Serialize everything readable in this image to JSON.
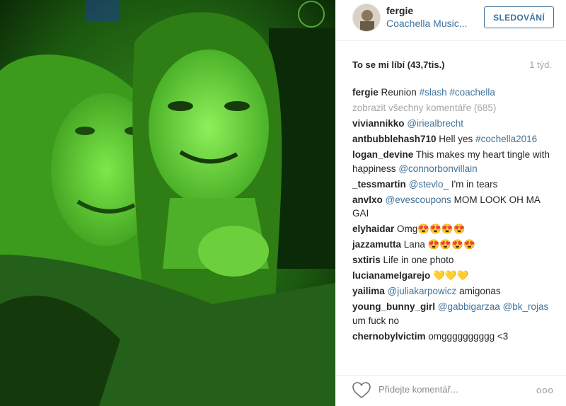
{
  "header": {
    "username": "fergie",
    "location": "Coachella Music...",
    "follow_label": "SLEDOVÁNÍ"
  },
  "stats": {
    "likes": "To se mi líbí (43,7tis.)",
    "time": "1 týd."
  },
  "caption": {
    "user": "fergie",
    "text": "Reunion",
    "tags": [
      "#slash",
      "#coachella"
    ]
  },
  "view_all": "zobrazit všechny komentáře (685)",
  "comments": [
    {
      "user": "viviannikko",
      "tag1": "@iriealbrecht",
      "text": ""
    },
    {
      "user": "antbubblehash710",
      "text": "Hell yes",
      "tag1": "#cochella2016"
    },
    {
      "user": "logan_devine",
      "text": "This makes my heart tingle with happiness",
      "tag1": "@connorbonvillain"
    },
    {
      "user": "_tessmartin",
      "tag1": "@stevlo_",
      "text": "I'm in tears"
    },
    {
      "user": "anvlxo",
      "tag1": "@evescoupons",
      "text": "MOM LOOK OH MA GAI"
    },
    {
      "user": "elyhaidar",
      "text": "Omg😍😍😍😍"
    },
    {
      "user": "jazzamutta",
      "text": "Lana 😍😍😍😍"
    },
    {
      "user": "sxtiris",
      "text": "Life in one photo"
    },
    {
      "user": "lucianamelgarejo",
      "text": "💛💛💛"
    },
    {
      "user": "yailima",
      "tag1": "@juliakarpowicz",
      "text": "amigonas"
    },
    {
      "user": "young_bunny_girl",
      "tag1": "@gabbigarzaa",
      "tag2": "@bk_rojas",
      "text": "um fuck no"
    },
    {
      "user": "chernobylvictim",
      "text": "omgggggggggg <3"
    }
  ],
  "footer": {
    "placeholder": "Přidejte komentář...",
    "more": "ooo"
  },
  "icons": {
    "like": "heart-outline-icon",
    "options": "more-options-icon"
  },
  "colors": {
    "link": "#3f729b",
    "muted": "#a5a7aa",
    "text": "#262626"
  }
}
